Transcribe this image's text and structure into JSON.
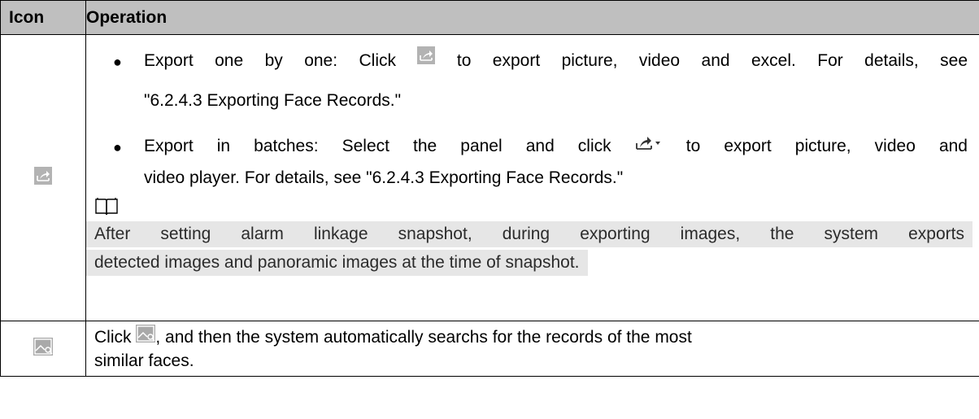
{
  "table": {
    "header": {
      "col1": "Icon",
      "col2": "Operation"
    },
    "row1": {
      "icon": "export-icon",
      "bullet1_line1_pre": "Export one by one: Click ",
      "bullet1_line1_post": " to export picture, video and excel. For details, see",
      "bullet1_line2": "\"6.2.4.3 Exporting Face Records.\"",
      "bullet2_line1_pre": "Export in batches: Select the panel and click ",
      "bullet2_line1_post": " to export picture, video and",
      "bullet2_line2": "video player. For details, see \"6.2.4.3 Exporting Face Records.\"",
      "note_icon": "book-note-icon",
      "note_line1": "After setting alarm linkage snapshot, during exporting images, the system exports",
      "note_line2": "detected images and panoramic images at the time of snapshot."
    },
    "row2": {
      "icon": "image-search-icon",
      "line1_pre": "Click ",
      "line1_post": ", and then the system automatically searchs for the records of the most",
      "line2": "similar faces."
    }
  },
  "colors": {
    "header_bg": "#bfbfbf",
    "note_bg": "#e6e6e6",
    "icon_gray": "#a9a9a9"
  }
}
